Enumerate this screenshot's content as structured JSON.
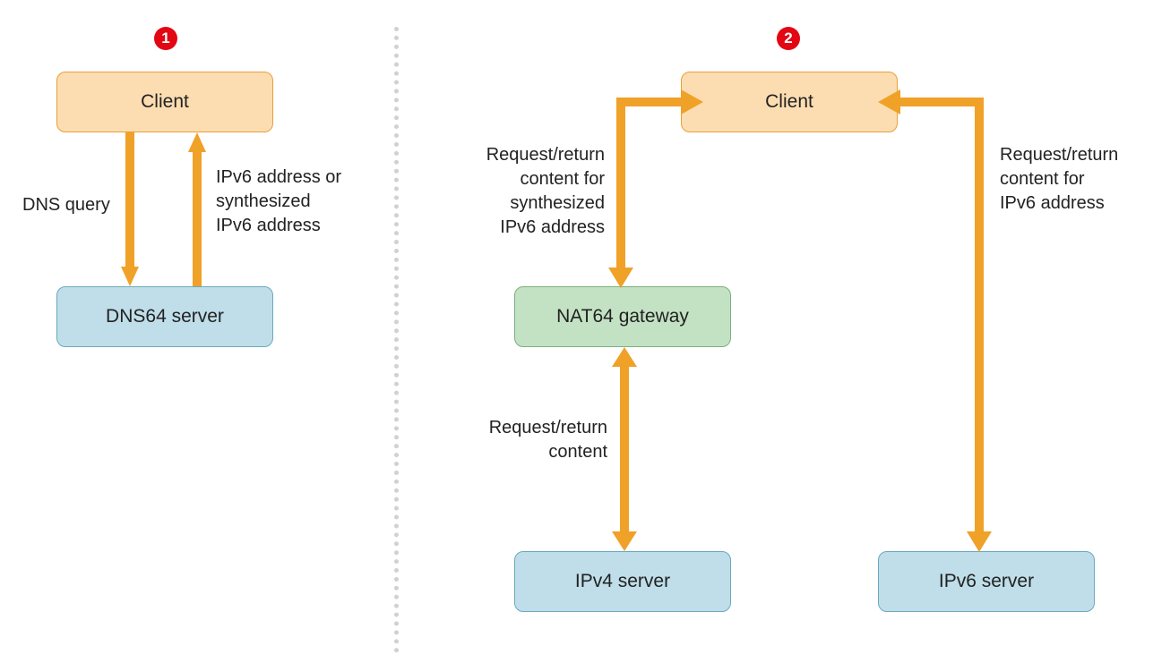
{
  "panel1": {
    "badge": "1",
    "client": "Client",
    "dns64": "DNS64 server",
    "label_query": "DNS query",
    "label_v6": "IPv6 address or\nsynthesized\nIPv6 address"
  },
  "panel2": {
    "badge": "2",
    "client": "Client",
    "nat64": "NAT64 gateway",
    "ipv4": "IPv4 server",
    "ipv6": "IPv6 server",
    "label_synth": "Request/return\ncontent for\nsynthesized\nIPv6 address",
    "label_middle": "Request/return\ncontent",
    "label_v6flow": "Request/return\ncontent for\nIPv6 address"
  },
  "colors": {
    "arrow": "#f0a128"
  }
}
